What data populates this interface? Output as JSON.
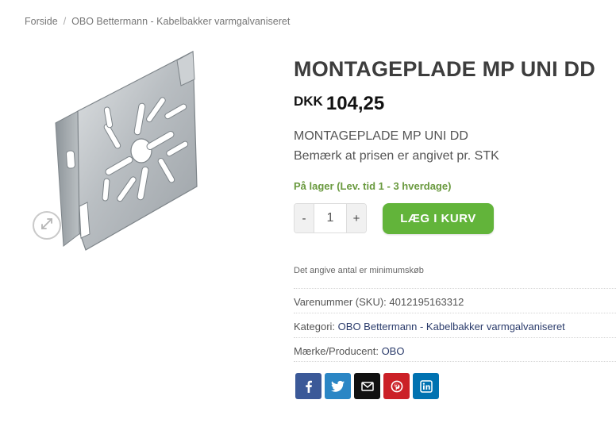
{
  "breadcrumb": {
    "home": "Forside",
    "separator": "/",
    "category": "OBO Bettermann - Kabelbakker varmgalvaniseret"
  },
  "product": {
    "title": "MONTAGEPLADE MP UNI DD",
    "currency": "DKK",
    "price": "104,25",
    "description_line1": "MONTAGEPLADE MP UNI DD",
    "description_line2": "Bemærk at prisen er angivet pr. STK",
    "stock": "På lager (Lev. tid 1 - 3 hverdage)",
    "min_note": "Det angive antal er minimumskøb"
  },
  "quantity": {
    "minus": "-",
    "value": "1",
    "plus": "+"
  },
  "add_to_cart": "LÆG I KURV",
  "meta": {
    "sku_label": "Varenummer (SKU):",
    "sku": "4012195163312",
    "category_label": "Kategori:",
    "category": "OBO Bettermann - Kabelbakker varmgalvaniseret",
    "brand_label": "Mærke/Producent:",
    "brand": "OBO"
  },
  "share": [
    {
      "icon": "facebook-icon",
      "color": "#3b5998"
    },
    {
      "icon": "twitter-icon",
      "color": "#2b86c5"
    },
    {
      "icon": "email-icon",
      "color": "#111111"
    },
    {
      "icon": "pinterest-icon",
      "color": "#cb2027"
    },
    {
      "icon": "linkedin-icon",
      "color": "#0072b1"
    }
  ],
  "colors": {
    "accent": "#62b43a",
    "stock": "#6a9a3f",
    "link": "#2a3b6b"
  }
}
